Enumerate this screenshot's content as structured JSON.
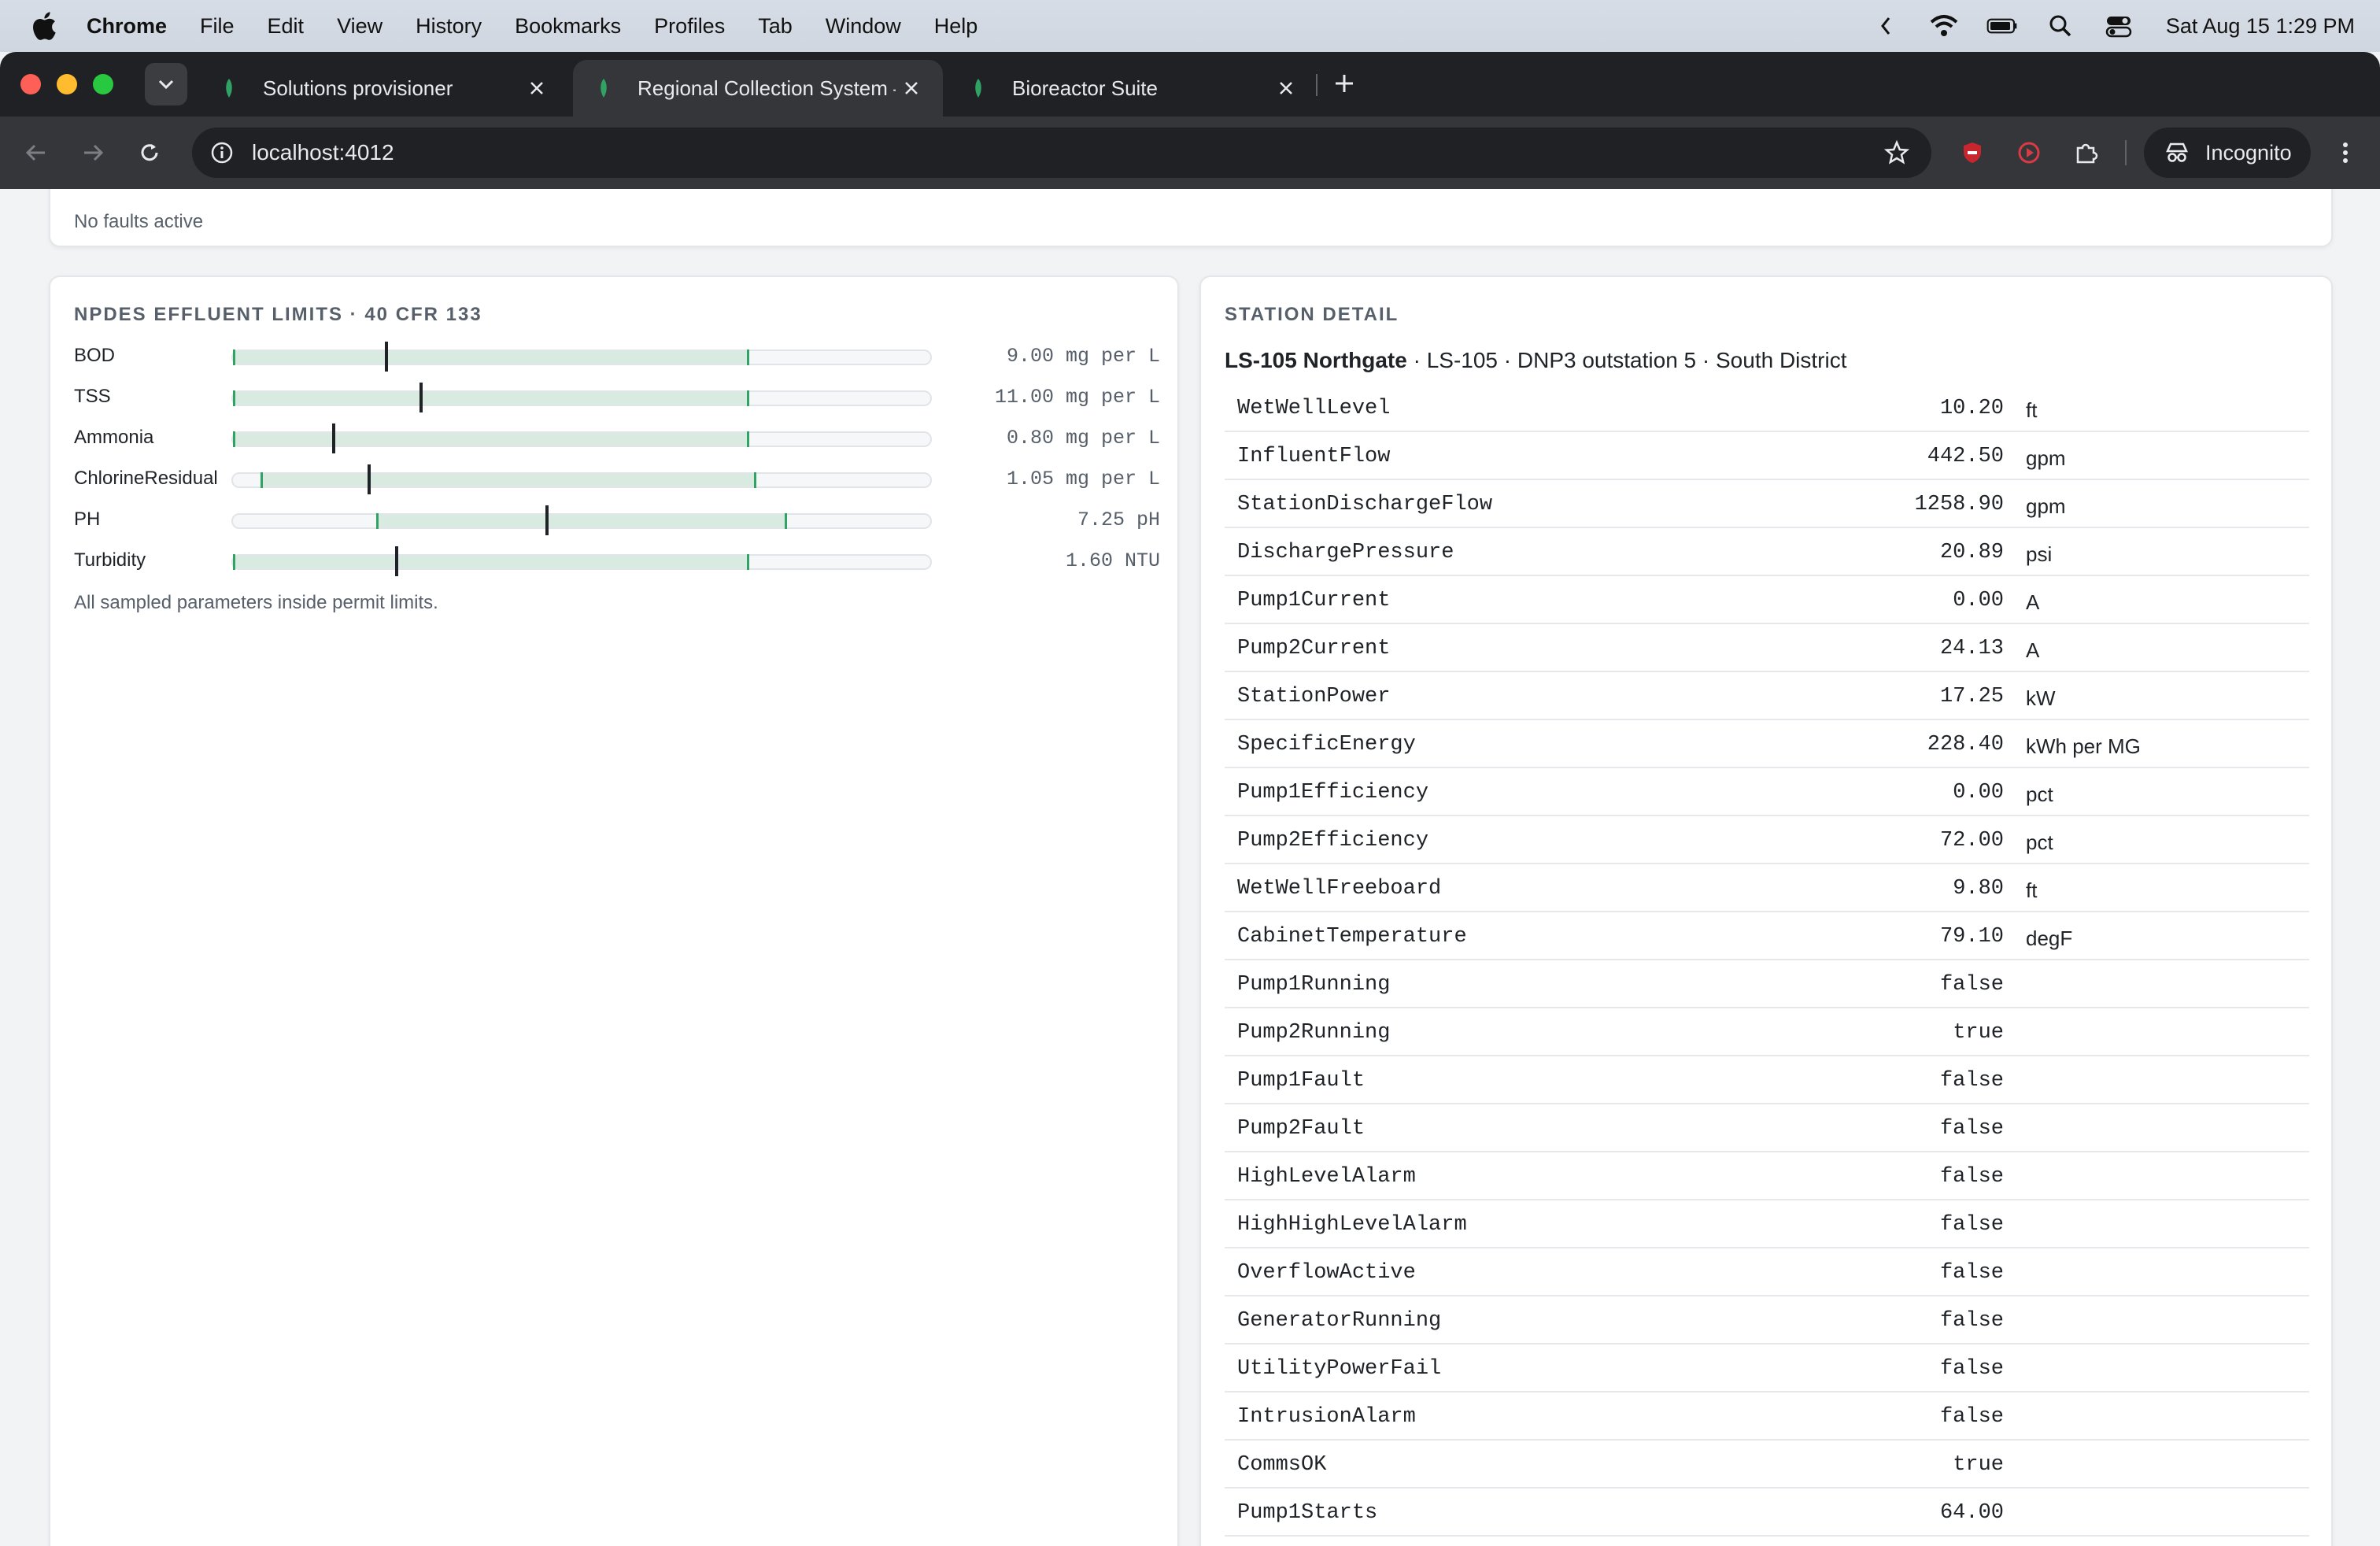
{
  "menubar": {
    "app": "Chrome",
    "items": [
      "File",
      "Edit",
      "View",
      "History",
      "Bookmarks",
      "Profiles",
      "Tab",
      "Window",
      "Help"
    ],
    "clock": "Sat Aug 15  1:29 PM"
  },
  "browser": {
    "tabs": [
      {
        "title": "Solutions provisioner"
      },
      {
        "title": "Regional Collection System –"
      },
      {
        "title": "Bioreactor Suite"
      }
    ],
    "active_tab": 1,
    "url": "localhost:4012",
    "incognito_label": "Incognito"
  },
  "faults": {
    "text": "No faults active"
  },
  "limits": {
    "title": "NPDES EFFLUENT LIMITS · 40 CFR 133",
    "rows": [
      {
        "name": "BOD",
        "value": "9.00 mg per L",
        "band_lo": 0.0,
        "band_hi": 0.74,
        "needle": 0.22
      },
      {
        "name": "TSS",
        "value": "11.00 mg per L",
        "band_lo": 0.0,
        "band_hi": 0.74,
        "needle": 0.27
      },
      {
        "name": "Ammonia",
        "value": "0.80 mg per L",
        "band_lo": 0.0,
        "band_hi": 0.74,
        "needle": 0.145
      },
      {
        "name": "ChlorineResidual",
        "value": "1.05 mg per L",
        "band_lo": 0.04,
        "band_hi": 0.75,
        "needle": 0.195
      },
      {
        "name": "PH",
        "value": "7.25 pH",
        "band_lo": 0.205,
        "band_hi": 0.795,
        "needle": 0.45
      },
      {
        "name": "Turbidity",
        "value": "1.60 NTU",
        "band_lo": 0.0,
        "band_hi": 0.74,
        "needle": 0.235
      }
    ],
    "note": "All sampled parameters inside permit limits."
  },
  "station": {
    "title": "STATION DETAIL",
    "name": "LS-105 Northgate",
    "meta": " · LS-105 · DNP3 outstation 5 · South District",
    "points": [
      {
        "name": "WetWellLevel",
        "value": "10.20",
        "unit": "ft"
      },
      {
        "name": "InfluentFlow",
        "value": "442.50",
        "unit": "gpm"
      },
      {
        "name": "StationDischargeFlow",
        "value": "1258.90",
        "unit": "gpm"
      },
      {
        "name": "DischargePressure",
        "value": "20.89",
        "unit": "psi"
      },
      {
        "name": "Pump1Current",
        "value": "0.00",
        "unit": "A"
      },
      {
        "name": "Pump2Current",
        "value": "24.13",
        "unit": "A"
      },
      {
        "name": "StationPower",
        "value": "17.25",
        "unit": "kW"
      },
      {
        "name": "SpecificEnergy",
        "value": "228.40",
        "unit": "kWh per MG"
      },
      {
        "name": "Pump1Efficiency",
        "value": "0.00",
        "unit": "pct"
      },
      {
        "name": "Pump2Efficiency",
        "value": "72.00",
        "unit": "pct"
      },
      {
        "name": "WetWellFreeboard",
        "value": "9.80",
        "unit": "ft"
      },
      {
        "name": "CabinetTemperature",
        "value": "79.10",
        "unit": "degF"
      },
      {
        "name": "Pump1Running",
        "value": "false",
        "unit": ""
      },
      {
        "name": "Pump2Running",
        "value": "true",
        "unit": ""
      },
      {
        "name": "Pump1Fault",
        "value": "false",
        "unit": ""
      },
      {
        "name": "Pump2Fault",
        "value": "false",
        "unit": ""
      },
      {
        "name": "HighLevelAlarm",
        "value": "false",
        "unit": ""
      },
      {
        "name": "HighHighLevelAlarm",
        "value": "false",
        "unit": ""
      },
      {
        "name": "OverflowActive",
        "value": "false",
        "unit": ""
      },
      {
        "name": "GeneratorRunning",
        "value": "false",
        "unit": ""
      },
      {
        "name": "UtilityPowerFail",
        "value": "false",
        "unit": ""
      },
      {
        "name": "IntrusionAlarm",
        "value": "false",
        "unit": ""
      },
      {
        "name": "CommsOK",
        "value": "true",
        "unit": ""
      },
      {
        "name": "Pump1Starts",
        "value": "64.00",
        "unit": ""
      }
    ]
  },
  "colors": {
    "band": "#d9ebe0",
    "band_edge": "#2fa264",
    "needle": "#1f2328"
  }
}
